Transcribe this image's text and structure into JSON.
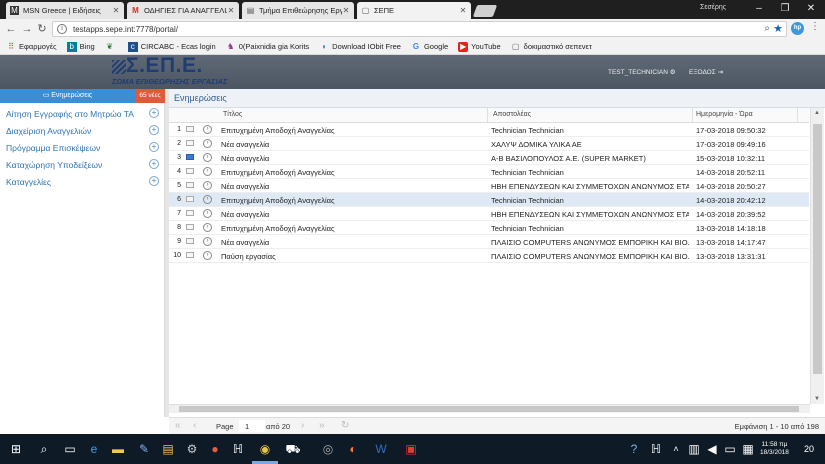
{
  "browser": {
    "tabs": [
      {
        "title": "MSN Greece | Ειδήσεις",
        "icon": "msn-icon"
      },
      {
        "title": "ΟΔΗΓΙΕΣ ΓΙΑ ΑΝΑΓΓΕΛΙΑ",
        "icon": "gmail-icon"
      },
      {
        "title": "Τμήμα Επιθεώρησης Εργ",
        "icon": "document-icon"
      },
      {
        "title": "ΣΕΠΕ",
        "icon": "page-icon"
      }
    ],
    "window_user": "Σεσέρης",
    "url": "testapps.sepe.int:7778/portal/",
    "bookmarks": [
      {
        "label": "Εφαρμογές",
        "icon": "apps-grid-icon"
      },
      {
        "label": "Bing",
        "icon": "bing-icon"
      },
      {
        "label": "",
        "icon": "leaf-icon"
      },
      {
        "label": "CIRCABC - Ecas login",
        "icon": "circabc-icon"
      },
      {
        "label": "0(Paixnidia gia Korits",
        "icon": "game-icon"
      },
      {
        "label": "Download IObit Free",
        "icon": "iobit-icon"
      },
      {
        "label": "Google",
        "icon": "google-icon"
      },
      {
        "label": "YouTube",
        "icon": "youtube-icon"
      },
      {
        "label": "δοκιμαστικό σεπενετ",
        "icon": "page-icon"
      }
    ]
  },
  "app": {
    "logo_big": "Σ.ΕΠ.Ε.",
    "logo_small": "ΣΩΜΑ ΕΠΙΘΕΩΡΗΣΗΣ ΕΡΓΑΣΙΑΣ",
    "user": "TEST_TECHNICIAN",
    "logout": "ΕΞΟΔΟΣ"
  },
  "sidebar": {
    "notifications_label": "Ενημερώσεις",
    "notifications_count": "65 νέες",
    "items": [
      {
        "label": "Αίτηση Εγγραφής στο Μητρώο ΤΑ"
      },
      {
        "label": "Διαχείριση Αναγγελιών"
      },
      {
        "label": "Πρόγραμμα Επισκέψεων"
      },
      {
        "label": "Καταχώρηση Υποδείξεων"
      },
      {
        "label": "Καταγγελίες"
      }
    ]
  },
  "main": {
    "title": "Ενημερώσεις",
    "columns": {
      "title": "Τίτλος",
      "sender": "Αποστολέας",
      "date": "Ημερομηνία - Ώρα"
    },
    "rows": [
      {
        "num": "1",
        "title": "Επιτυχημένη Αποδοχή Αναγγελίας",
        "sender": "Technician Technician",
        "date": "17-03-2018 09:50:32",
        "unread": false,
        "selected": false
      },
      {
        "num": "2",
        "title": "Νέα αναγγελία",
        "sender": "ΧΑΛΥΨ ΔΟΜΙΚΑ ΥΛΙΚΑ ΑΕ",
        "date": "17-03-2018 09:49:16",
        "unread": false,
        "selected": false
      },
      {
        "num": "3",
        "title": "Νέα αναγγελία",
        "sender": "Α-Β ΒΑΣΙΛΟΠΟΥΛΟΣ Α.Ε. (SUPER MARKET)",
        "date": "15-03-2018 10:32:11",
        "unread": true,
        "selected": false
      },
      {
        "num": "4",
        "title": "Επιτυχημένη Αποδοχή Αναγγελίας",
        "sender": "Technician Technician",
        "date": "14-03-2018 20:52:11",
        "unread": false,
        "selected": false
      },
      {
        "num": "5",
        "title": "Νέα αναγγελία",
        "sender": "ΗΒΗ ΕΠΕΝΔΥΣΕΩΝ ΚΑΙ ΣΥΜΜΕΤΟΧΩΝ ΑΝΩΝΥΜΟΣ ΕΤΑΙ",
        "date": "14-03-2018 20:50:27",
        "unread": false,
        "selected": false
      },
      {
        "num": "6",
        "title": "Επιτυχημένη Αποδοχή Αναγγελίας",
        "sender": "Technician Technician",
        "date": "14-03-2018 20:42:12",
        "unread": false,
        "selected": true
      },
      {
        "num": "7",
        "title": "Νέα αναγγελία",
        "sender": "ΗΒΗ ΕΠΕΝΔΥΣΕΩΝ ΚΑΙ ΣΥΜΜΕΤΟΧΩΝ ΑΝΩΝΥΜΟΣ ΕΤΑΙ",
        "date": "14-03-2018 20:39:52",
        "unread": false,
        "selected": false
      },
      {
        "num": "8",
        "title": "Επιτυχημένη Αποδοχή Αναγγελίας",
        "sender": "Technician Technician",
        "date": "13-03-2018 14:18:18",
        "unread": false,
        "selected": false
      },
      {
        "num": "9",
        "title": "Νέα αναγγελία",
        "sender": "ΠΛΑΙΣΙΟ COMPUTERS ΑΝΩΝΥΜΟΣ ΕΜΠΟΡΙΚΗ ΚΑΙ ΒΙΟ...",
        "date": "13-03-2018 14:17:47",
        "unread": false,
        "selected": false
      },
      {
        "num": "10",
        "title": "Παύση εργασίας",
        "sender": "ΠΛΑΙΣΙΟ COMPUTERS ΑΝΩΝΥΜΟΣ ΕΜΠΟΡΙΚΗ ΚΑΙ ΒΙΟ...",
        "date": "13-03-2018 13:31:31",
        "unread": false,
        "selected": false
      }
    ]
  },
  "pager": {
    "page_label": "Page",
    "page_value": "1",
    "of_label": "από 20",
    "info": "Εμφάνιση 1 - 10 από 198"
  },
  "taskbar": {
    "time": "11:58 πμ",
    "date": "18/3/2018",
    "notif_count": "20"
  },
  "colors": {
    "header": "#566270",
    "accent": "#3a8ed6",
    "badge": "#e05a3a",
    "link": "#2d73b5",
    "selected_row": "#dfe9f5"
  }
}
